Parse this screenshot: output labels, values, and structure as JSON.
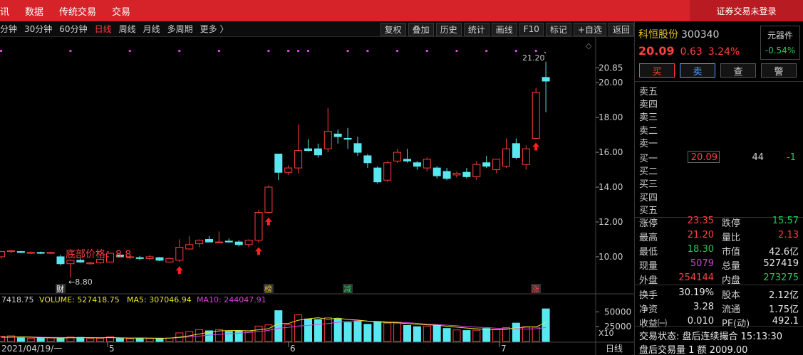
{
  "menu": [
    "讯",
    "数据",
    "传统交易",
    "交易"
  ],
  "login_status": "证券交易未登录",
  "periods": [
    {
      "label": "分钟",
      "active": false
    },
    {
      "label": "30分钟",
      "active": false
    },
    {
      "label": "60分钟",
      "active": false
    },
    {
      "label": "日线",
      "active": true
    },
    {
      "label": "周线",
      "active": false
    },
    {
      "label": "月线",
      "active": false
    },
    {
      "label": "多周期",
      "active": false
    },
    {
      "label": "更多 〉",
      "active": false
    }
  ],
  "tools": [
    "复权",
    "叠加",
    "历史",
    "统计",
    "画线",
    "F10",
    "标记",
    "+自选",
    "返回"
  ],
  "stock": {
    "name": "科恒股份",
    "code": "300340",
    "price": "20.09",
    "change": "0.63",
    "change_pct": "3.24%",
    "sector_name": "元器件",
    "sector_pct": "-0.54%"
  },
  "trade_buttons": {
    "buy": "买",
    "sell": "卖",
    "query": "查",
    "alert": "警"
  },
  "orderbook": {
    "asks": [
      "卖五",
      "卖四",
      "卖三",
      "卖二",
      "卖一"
    ],
    "bid1": {
      "label": "买一",
      "price": "20.09",
      "volume": "44",
      "change": "-1"
    },
    "bids": [
      "买二",
      "买三",
      "买四",
      "买五"
    ]
  },
  "stats": [
    {
      "l1": "涨停",
      "v1": "23.35",
      "c1": "red",
      "l2": "跌停",
      "v2": "15.57",
      "c2": "green"
    },
    {
      "l1": "最高",
      "v1": "21.20",
      "c1": "red",
      "l2": "量比",
      "v2": "2.13",
      "c2": "red"
    },
    {
      "l1": "最低",
      "v1": "18.30",
      "c1": "green",
      "l2": "市值",
      "v2": "42.6亿",
      "c2": "white"
    },
    {
      "l1": "现量",
      "v1": "5079",
      "c1": "purple",
      "l2": "总量",
      "v2": "527419",
      "c2": "white"
    },
    {
      "l1": "外盘",
      "v1": "254144",
      "c1": "red",
      "l2": "内盘",
      "v2": "273275",
      "c2": "green"
    },
    {
      "l1": "换手",
      "v1": "30.19%",
      "c1": "white",
      "l2": "股本",
      "v2": "2.12亿",
      "c2": "white"
    },
    {
      "l1": "净资",
      "v1": "3.28",
      "c1": "white",
      "l2": "流通",
      "v2": "1.75亿",
      "c2": "white"
    },
    {
      "l1": "收益㈠",
      "v1": "0.010",
      "c1": "white",
      "l2": "PE(动)",
      "v2": "492.1",
      "c2": "white"
    }
  ],
  "status": {
    "trade_state": "交易状态: 盘后连续撮合 15:13:30",
    "after_hours": "盘后交易量 1 额 2009.00"
  },
  "chart_data": {
    "type": "candlestick",
    "price_axis_ticks": [
      "20.85",
      "20.00",
      "18.00",
      "16.00",
      "14.00",
      "12.00",
      "10.00"
    ],
    "ylim": [
      8.2,
      21.6
    ],
    "candles": [
      {
        "o": 10.0,
        "h": 10.3,
        "l": 9.9,
        "c": 10.3
      },
      {
        "o": 10.3,
        "h": 10.4,
        "l": 10.2,
        "c": 10.35
      },
      {
        "o": 10.3,
        "h": 10.35,
        "l": 10.2,
        "c": 10.25
      },
      {
        "o": 10.2,
        "h": 10.3,
        "l": 10.15,
        "c": 10.25
      },
      {
        "o": 10.25,
        "h": 10.3,
        "l": 10.15,
        "c": 10.2
      },
      {
        "o": 10.2,
        "h": 10.3,
        "l": 10.15,
        "c": 10.25
      },
      {
        "o": 10.0,
        "h": 10.1,
        "l": 9.5,
        "c": 9.6
      },
      {
        "o": 9.6,
        "h": 9.85,
        "l": 8.8,
        "c": 9.8
      },
      {
        "o": 9.8,
        "h": 9.9,
        "l": 9.65,
        "c": 9.7
      },
      {
        "o": 9.6,
        "h": 9.7,
        "l": 9.55,
        "c": 9.65
      },
      {
        "o": 9.65,
        "h": 9.9,
        "l": 9.6,
        "c": 9.85
      },
      {
        "o": 9.7,
        "h": 10.25,
        "l": 9.65,
        "c": 10.2
      },
      {
        "o": 10.1,
        "h": 10.2,
        "l": 9.95,
        "c": 10.0
      },
      {
        "o": 9.95,
        "h": 10.05,
        "l": 9.85,
        "c": 10.0
      },
      {
        "o": 9.95,
        "h": 10.05,
        "l": 9.8,
        "c": 9.9
      },
      {
        "o": 9.9,
        "h": 10.1,
        "l": 9.8,
        "c": 10.0
      },
      {
        "o": 9.95,
        "h": 10.0,
        "l": 9.75,
        "c": 9.8
      },
      {
        "o": 9.7,
        "h": 9.95,
        "l": 9.7,
        "c": 9.9
      },
      {
        "o": 9.8,
        "h": 11.0,
        "l": 9.7,
        "c": 10.55
      },
      {
        "o": 10.45,
        "h": 11.2,
        "l": 10.4,
        "c": 10.7
      },
      {
        "o": 10.75,
        "h": 11.0,
        "l": 10.55,
        "c": 10.95
      },
      {
        "o": 11.0,
        "h": 11.2,
        "l": 10.85,
        "c": 10.85
      },
      {
        "o": 10.85,
        "h": 11.45,
        "l": 10.8,
        "c": 10.85
      },
      {
        "o": 10.9,
        "h": 11.05,
        "l": 10.8,
        "c": 10.85
      },
      {
        "o": 10.85,
        "h": 10.95,
        "l": 10.6,
        "c": 10.7
      },
      {
        "o": 10.7,
        "h": 11.0,
        "l": 10.55,
        "c": 10.95
      },
      {
        "o": 10.95,
        "h": 12.7,
        "l": 10.8,
        "c": 12.55
      },
      {
        "o": 12.55,
        "h": 14.1,
        "l": 12.5,
        "c": 14.0
      },
      {
        "o": 15.9,
        "h": 15.9,
        "l": 14.4,
        "c": 14.85
      },
      {
        "o": 14.85,
        "h": 15.25,
        "l": 14.7,
        "c": 15.1
      },
      {
        "o": 15.1,
        "h": 17.6,
        "l": 14.8,
        "c": 16.1
      },
      {
        "o": 16.2,
        "h": 16.75,
        "l": 16.05,
        "c": 16.1
      },
      {
        "o": 16.2,
        "h": 16.5,
        "l": 15.7,
        "c": 15.85
      },
      {
        "o": 16.2,
        "h": 18.55,
        "l": 16.0,
        "c": 17.2
      },
      {
        "o": 17.05,
        "h": 17.3,
        "l": 16.5,
        "c": 16.9
      },
      {
        "o": 16.8,
        "h": 17.4,
        "l": 16.2,
        "c": 16.75
      },
      {
        "o": 16.5,
        "h": 16.9,
        "l": 15.8,
        "c": 16.0
      },
      {
        "o": 15.8,
        "h": 15.9,
        "l": 15.1,
        "c": 15.4
      },
      {
        "o": 15.1,
        "h": 15.2,
        "l": 14.2,
        "c": 14.3
      },
      {
        "o": 14.4,
        "h": 15.5,
        "l": 14.3,
        "c": 15.4
      },
      {
        "o": 15.5,
        "h": 16.2,
        "l": 15.4,
        "c": 16.0
      },
      {
        "o": 15.6,
        "h": 16.2,
        "l": 15.4,
        "c": 15.5
      },
      {
        "o": 15.4,
        "h": 15.5,
        "l": 15.0,
        "c": 15.2
      },
      {
        "o": 15.1,
        "h": 15.7,
        "l": 14.9,
        "c": 15.6
      },
      {
        "o": 15.1,
        "h": 15.2,
        "l": 14.5,
        "c": 14.65
      },
      {
        "o": 14.9,
        "h": 15.1,
        "l": 14.4,
        "c": 14.5
      },
      {
        "o": 14.7,
        "h": 14.9,
        "l": 14.55,
        "c": 14.8
      },
      {
        "o": 14.85,
        "h": 15.1,
        "l": 14.5,
        "c": 14.6
      },
      {
        "o": 14.6,
        "h": 15.5,
        "l": 14.4,
        "c": 15.3
      },
      {
        "o": 15.4,
        "h": 15.8,
        "l": 15.1,
        "c": 15.2
      },
      {
        "o": 15.0,
        "h": 15.6,
        "l": 14.8,
        "c": 15.6
      },
      {
        "o": 15.2,
        "h": 16.8,
        "l": 15.1,
        "c": 16.2
      },
      {
        "o": 16.5,
        "h": 16.8,
        "l": 15.6,
        "c": 15.7
      },
      {
        "o": 15.3,
        "h": 16.4,
        "l": 15.0,
        "c": 16.2
      },
      {
        "o": 16.8,
        "h": 19.7,
        "l": 16.8,
        "c": 19.45
      },
      {
        "o": 20.3,
        "h": 21.2,
        "l": 18.3,
        "c": 20.09
      }
    ],
    "volumes": [
      9000,
      9500,
      6000,
      5500,
      6500,
      6000,
      6000,
      7500,
      7000,
      5000,
      5500,
      8000,
      5000,
      4500,
      6000,
      5000,
      5500,
      6000,
      14500,
      17000,
      20000,
      18000,
      20000,
      17000,
      18000,
      17500,
      26000,
      28000,
      52000,
      28000,
      45000,
      38000,
      37000,
      40000,
      38000,
      32000,
      34000,
      29000,
      33000,
      31000,
      31000,
      27000,
      25000,
      26000,
      28000,
      22000,
      19500,
      18500,
      19000,
      22000,
      20000,
      23500,
      31000,
      25000,
      24000,
      55000
    ],
    "ma5": [
      7000,
      7300,
      7600,
      7400,
      6500,
      6100,
      6000,
      6200,
      6400,
      6300,
      6100,
      6600,
      6100,
      5600,
      5800,
      5600,
      5400,
      5500,
      7300,
      9600,
      12600,
      15800,
      17900,
      18400,
      18600,
      18000,
      19700,
      21600,
      30300,
      30300,
      35900,
      38200,
      40000,
      37600,
      39500,
      37000,
      36200,
      34400,
      33200,
      31800,
      31600,
      30200,
      29300,
      28000,
      27400,
      25700,
      24100,
      22600,
      21400,
      20200,
      19800,
      20600,
      23100,
      24300,
      24700,
      31700
    ],
    "ma10": [
      7500,
      7600,
      7700,
      7500,
      7200,
      6900,
      6700,
      6600,
      6600,
      6600,
      6500,
      6400,
      6200,
      6000,
      6000,
      5800,
      5700,
      5800,
      6500,
      7700,
      9100,
      10700,
      12000,
      13100,
      14100,
      15100,
      16700,
      18800,
      22300,
      23900,
      26100,
      27200,
      28900,
      30200,
      32400,
      34000,
      35100,
      34300,
      34000,
      33400,
      32700,
      31800,
      30600,
      29300,
      28500,
      27600,
      26500,
      25200,
      24100,
      23500,
      22300,
      21800,
      21400,
      21000,
      21400,
      23600
    ],
    "volume_ticks": [
      "50000",
      "25000"
    ],
    "volume_unit": "X10",
    "volume_legend": {
      "prefix": "7418.75",
      "volume": "VOLUME: 527418.75",
      "ma5": "MA5: 307046.94",
      "ma10": "MA10: 244047.91"
    },
    "date_labels": [
      {
        "text": "2021/04/19/一",
        "index": 5
      },
      {
        "text": "5",
        "index": 5
      },
      {
        "text": "6",
        "index": 27
      },
      {
        "text": "7",
        "index": 49
      }
    ],
    "timeframe_label": "日线",
    "annotations": {
      "bottom_price_text": "底部价格：8.8",
      "low_marker": "←8.80",
      "high_marker": "21.20",
      "badges": [
        {
          "text": "财",
          "index": 6,
          "color": "#ffffff"
        },
        {
          "text": "榜",
          "index": 27,
          "color": "#e6c02a"
        },
        {
          "text": "减",
          "index": 35,
          "color": "#22cc55"
        },
        {
          "text": "涨",
          "index": 54,
          "color": "#ff4040"
        }
      ],
      "up_arrows_at": [
        18,
        26,
        27,
        54
      ],
      "signal_dots_at": [
        7,
        13,
        18,
        22,
        27,
        29,
        30,
        31,
        35,
        37,
        40,
        43,
        46,
        49,
        52,
        54
      ]
    }
  }
}
